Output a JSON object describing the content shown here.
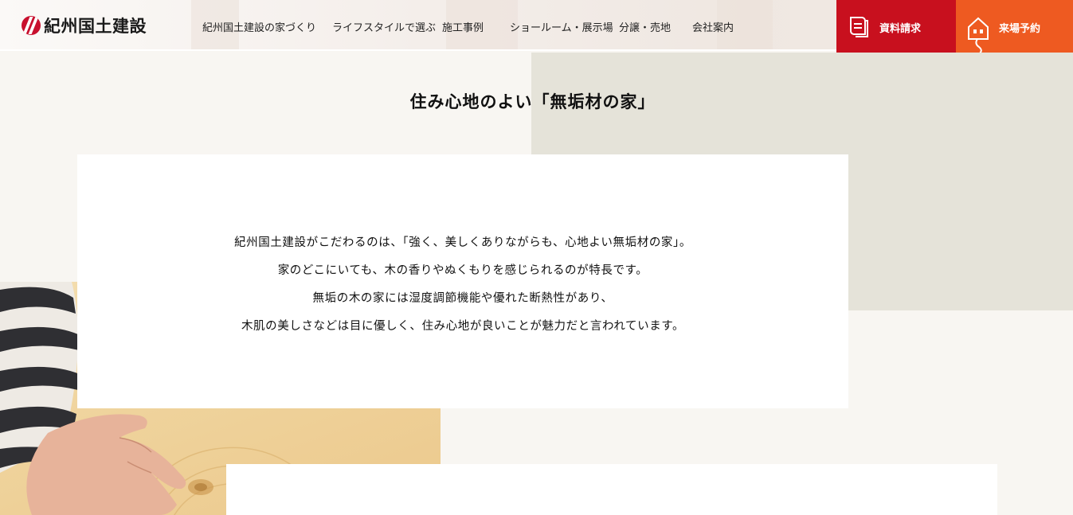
{
  "brand": {
    "name": "紀州国土建設",
    "logo_color": "#c8102e"
  },
  "nav": {
    "items": [
      "紀州国土建設の家づくり",
      "ライフスタイルで選ぶ",
      "施工事例",
      "ショールーム・展示場",
      "分譲・売地",
      "会社案内"
    ]
  },
  "cta": {
    "request": {
      "label": "資料請求",
      "icon": "book-icon",
      "color": "#c8101e"
    },
    "visit": {
      "label": "来場予約",
      "icon": "house-icon",
      "color": "#ee5a21"
    }
  },
  "section": {
    "title": "住み心地のよい「無垢材の家」",
    "body": [
      "紀州国土建設がこだわるのは、「強く、美しくありながらも、心地よい無垢材の家」。",
      "家のどこにいても、木の香りやぬくもりを感じられるのが特長です。",
      "無垢の木の家には湿度調節機能や優れた断熱性があり、",
      "木肌の美しさなどは目に優しく、住み心地が良いことが魅力だと言われています。"
    ]
  },
  "colors": {
    "page_bg": "#f8f6f2",
    "beige_block": "#e5e3d9",
    "card_bg": "#ffffff"
  }
}
